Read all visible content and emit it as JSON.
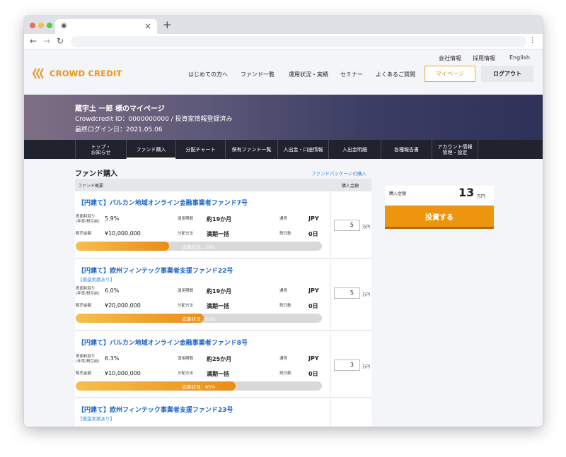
{
  "browser": {
    "tab_close": "×",
    "new_tab": "+",
    "back": "←",
    "forward": "→",
    "reload": "↻",
    "menu": "⋮"
  },
  "header": {
    "utility_links": [
      "会社情報",
      "採用情報",
      "English"
    ],
    "logo_text": "CROWD CREDIT",
    "brand_color": "#e89513",
    "nav": [
      "はじめての方へ",
      "ファンド一覧",
      "運用状況・実績",
      "セミナー",
      "よくあるご質問"
    ],
    "mypage_label": "マイページ",
    "logout_label": "ログアウト"
  },
  "hero": {
    "title": "蔵宇土 一郎 様のマイページ",
    "id_line": "Crowdcredit ID：0000000000 /  投資家情報登録済み",
    "last_login": "最終ログイン日：2021.05.06"
  },
  "tabs": [
    {
      "label": "トップ・\nお知らせ",
      "active": false
    },
    {
      "label": "ファンド購入",
      "active": true
    },
    {
      "label": "分配チャート",
      "active": false
    },
    {
      "label": "保有ファンド一覧",
      "active": false
    },
    {
      "label": "入出金・口座情報",
      "active": false
    },
    {
      "label": "入出金明細",
      "active": false
    },
    {
      "label": "各種報告書",
      "active": false
    },
    {
      "label": "アカウント情報\n管理・設定",
      "active": false
    }
  ],
  "purchase": {
    "title": "ファンド購入",
    "package_link": "ファンドパッケージの購入",
    "col_overview": "ファンド概要",
    "col_amount": "購入金額",
    "labels": {
      "yield": "表面利回り\n(年率/税引前)",
      "period": "運用期間",
      "currency": "通貨",
      "sales": "販売金額",
      "distribution": "分配方法",
      "days_left": "残日数",
      "unit": "万円"
    },
    "funds": [
      {
        "title": "【円建て】バルカン地域オンライン金融事業者ファンド7号",
        "note": "",
        "yield": "5.9%",
        "period": "約19か月",
        "currency": "JPY",
        "sales": "¥10,000,000",
        "distribution": "満期一括",
        "days_left": "0日",
        "progress": 0.38,
        "progress_text": "応募状況：38%",
        "qty": "5"
      },
      {
        "title": "【円建て】欧州フィンテック事業者支援ファンド22号",
        "note": "【償還実績あり】",
        "yield": "6.0%",
        "period": "約19か月",
        "currency": "JPY",
        "sales": "¥20,000,000",
        "distribution": "満期一括",
        "days_left": "0日",
        "progress": 0.52,
        "progress_text": "応募状況：52%",
        "qty": "5"
      },
      {
        "title": "【円建て】バルカン地域オンライン金融事業者ファンド8号",
        "note": "",
        "yield": "6.3%",
        "period": "約25か月",
        "currency": "JPY",
        "sales": "¥10,000,000",
        "distribution": "満期一括",
        "days_left": "0日",
        "progress": 0.65,
        "progress_text": "応募状況：65%",
        "qty": "3"
      },
      {
        "title": "【円建て】欧州フィンテック事業者支援ファンド23号",
        "note": "【償還実績あり】"
      }
    ]
  },
  "summary": {
    "label": "購入金額",
    "value": "13",
    "unit": "万円",
    "invest_label": "投資する",
    "accent": "#ee950f"
  }
}
